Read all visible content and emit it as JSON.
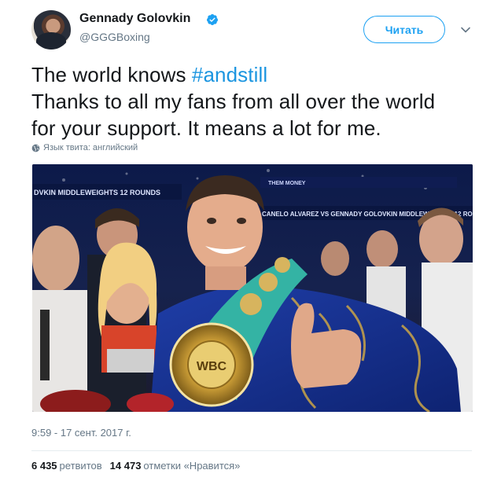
{
  "author": {
    "name": "Gennady Golovkin",
    "handle": "@GGGBoxing"
  },
  "follow_button": {
    "label": "Читать"
  },
  "tweet": {
    "text_prefix": "The world knows ",
    "hashtag": "#andstill",
    "line2": "Thanks to all my fans from all over the world",
    "line3": "for your support. It means a lot for me."
  },
  "language_note": "Язык твита: английский",
  "timestamp": "9:59 - 17 сент. 2017 г.",
  "stats": {
    "retweets_count": "6 435",
    "retweets_label": "ретвитов",
    "likes_count": "14 473",
    "likes_label": "отметки «Нравится»"
  },
  "photo_banner": {
    "left_text": "DVKIN  MIDDLEWEIGHTS  12 ROUNDS",
    "right_text": "CANELO ALVAREZ VS GENNADY GOLOVKIN  MIDDLEWEIGHTS  12 ROU",
    "top_text": "THEM MONEY"
  },
  "colors": {
    "accent": "#1da1f2",
    "hashtag": "#1b95e0",
    "muted": "#657786",
    "text": "#14171a"
  },
  "icons": [
    "verified-badge-icon",
    "chevron-down-icon",
    "globe-icon"
  ]
}
